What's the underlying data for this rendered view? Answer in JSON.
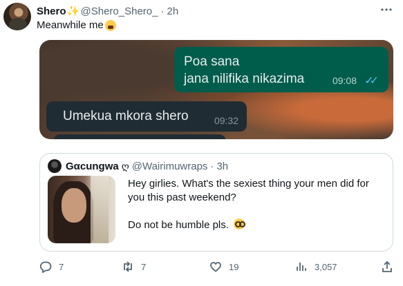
{
  "tweet": {
    "display_name": "Shero",
    "name_emoji": "✨",
    "handle": "@Shero_Shero_",
    "separator": "·",
    "time": "2h",
    "text": "Meanwhile me",
    "more_icon": "more-icon"
  },
  "media": {
    "outgoing": {
      "line1": "Poa sana",
      "line2": "jana nilifika nikazima",
      "time": "09:08",
      "ticks": "✓✓"
    },
    "incoming": {
      "text": "Umekua mkora shero",
      "time": "09:32"
    }
  },
  "quote": {
    "display_name": "Gαcungwa",
    "name_symbol": "ღ",
    "handle": "@Wairimuwraps",
    "separator": "·",
    "time": "3h",
    "text_p1": "Hey girlies. What's the sexiest thing your men did for you this past weekend?",
    "text_p2": "Do not be humble pls."
  },
  "actions": {
    "reply_count": "7",
    "retweet_count": "7",
    "like_count": "19",
    "views_count": "3,057"
  },
  "colors": {
    "text_primary": "#0f1419",
    "text_secondary": "#536471",
    "border": "#cfd9de",
    "whatsapp_outgoing": "#005c4b",
    "whatsapp_incoming": "#202c33",
    "read_ticks": "#53bdeb"
  }
}
